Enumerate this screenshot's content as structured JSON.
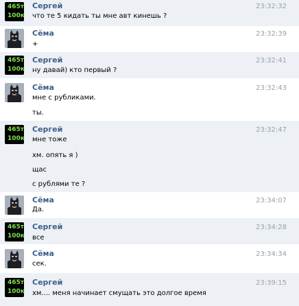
{
  "avatars": {
    "sergey": {
      "line1": "465т",
      "line2": "100к"
    }
  },
  "messages": [
    {
      "author": "Сергей",
      "time": "23:32:32",
      "lines": [
        "что те 5 кидать ты мне авт кинешь ?"
      ]
    },
    {
      "author": "Сёма",
      "time": "23:32:39",
      "lines": [
        "+"
      ]
    },
    {
      "author": "Сергей",
      "time": "23:32:41",
      "lines": [
        "ну давай) кто первый ?"
      ]
    },
    {
      "author": "Сёма",
      "time": "23:32:43",
      "lines": [
        "мне с рубликами.",
        "ты."
      ]
    },
    {
      "author": "Сергей",
      "time": "23:32:47",
      "lines": [
        "мне тоже",
        "хм. опять я )",
        "щас",
        "с рублями те ?"
      ]
    },
    {
      "author": "Сёма",
      "time": "23:34:07",
      "lines": [
        "Да."
      ]
    },
    {
      "author": "Сергей",
      "time": "23:34:28",
      "lines": [
        "все"
      ]
    },
    {
      "author": "Сёма",
      "time": "23:34:34",
      "lines": [
        "сек."
      ]
    },
    {
      "author": "Сергей",
      "time": "23:39:15",
      "lines": [
        "хм.... меня начинает смущать это долгое время"
      ]
    }
  ]
}
